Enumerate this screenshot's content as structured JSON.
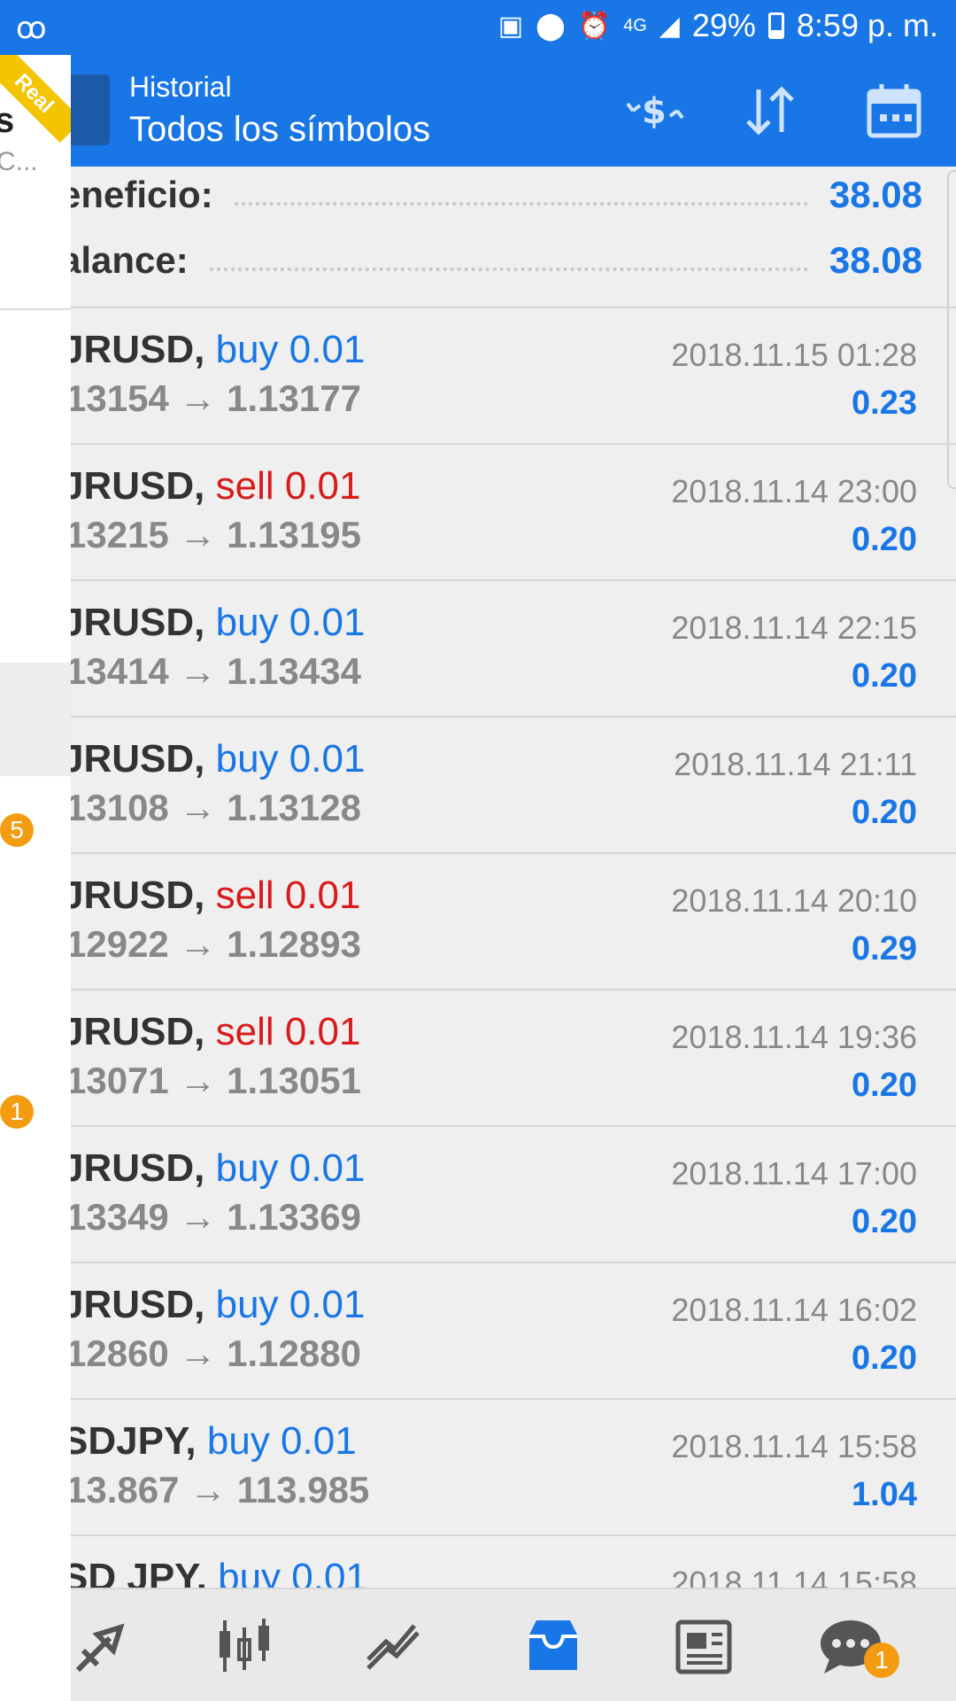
{
  "status_bar": {
    "battery_percent": "29%",
    "time": "8:59 p. m.",
    "network": "4G",
    "icons": [
      "voicemail-icon",
      "battery-saver-icon",
      "location-icon",
      "alarm-icon",
      "signal-icon",
      "battery-icon"
    ]
  },
  "drawer": {
    "ribbon": "Real",
    "partial_initial": "s",
    "partial_sub": "C...",
    "badges": [
      "5",
      "1"
    ]
  },
  "header": {
    "subtitle": "Historial",
    "title": "Todos los símbolos",
    "actions": [
      "currency-exchange-icon",
      "sort-icon",
      "calendar-icon"
    ]
  },
  "summary": {
    "profit_label": "eneficio:",
    "profit_value": "38.08",
    "balance_label": "alance:",
    "balance_value": "38.08"
  },
  "deals": [
    {
      "symbol": "JRUSD,",
      "side": "buy",
      "volume": "buy 0.01",
      "prices": "13154 → 1.13177",
      "time": "2018.11.15 01:28",
      "profit": "0.23"
    },
    {
      "symbol": "JRUSD,",
      "side": "sell",
      "volume": "sell 0.01",
      "prices": "13215 → 1.13195",
      "time": "2018.11.14 23:00",
      "profit": "0.20"
    },
    {
      "symbol": "JRUSD,",
      "side": "buy",
      "volume": "buy 0.01",
      "prices": "13414 → 1.13434",
      "time": "2018.11.14 22:15",
      "profit": "0.20"
    },
    {
      "symbol": "JRUSD,",
      "side": "buy",
      "volume": "buy 0.01",
      "prices": "13108 → 1.13128",
      "time": "2018.11.14 21:11",
      "profit": "0.20"
    },
    {
      "symbol": "JRUSD,",
      "side": "sell",
      "volume": "sell 0.01",
      "prices": "12922 → 1.12893",
      "time": "2018.11.14 20:10",
      "profit": "0.29"
    },
    {
      "symbol": "JRUSD,",
      "side": "sell",
      "volume": "sell 0.01",
      "prices": "13071 → 1.13051",
      "time": "2018.11.14 19:36",
      "profit": "0.20"
    },
    {
      "symbol": "JRUSD,",
      "side": "buy",
      "volume": "buy 0.01",
      "prices": "13349 → 1.13369",
      "time": "2018.11.14 17:00",
      "profit": "0.20"
    },
    {
      "symbol": "JRUSD,",
      "side": "buy",
      "volume": "buy 0.01",
      "prices": "12860 → 1.12880",
      "time": "2018.11.14 16:02",
      "profit": "0.20"
    },
    {
      "symbol": "SDJPY,",
      "side": "buy",
      "volume": "buy 0.01",
      "prices": "13.867 → 113.985",
      "time": "2018.11.14 15:58",
      "profit": "1.04"
    },
    {
      "symbol": "SD JPY,",
      "side": "buy",
      "volume": "buy 0.01",
      "prices": "",
      "time": "2018.11.14 15:58",
      "profit": ""
    }
  ],
  "bottom_nav": {
    "items": [
      "trade-icon",
      "quotes-icon",
      "chart-icon",
      "history-icon",
      "news-icon",
      "chat-icon"
    ],
    "active": "history-icon",
    "chat_badge": "1"
  }
}
